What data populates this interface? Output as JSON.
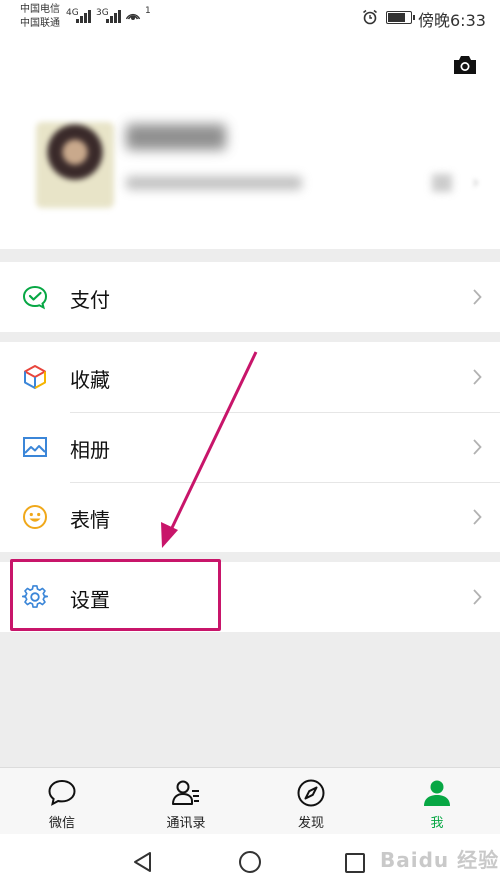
{
  "status_bar": {
    "carrier1": "中国电信",
    "carrier2": "中国联通",
    "net1": "4G",
    "net2": "3G",
    "hotspot_count": "1",
    "time": "傍晚6:33"
  },
  "menu": {
    "pay": "支付",
    "favorites": "收藏",
    "album": "相册",
    "stickers": "表情",
    "settings": "设置"
  },
  "tabs": [
    {
      "label": "微信",
      "icon": "chat-bubble-icon"
    },
    {
      "label": "通讯录",
      "icon": "contacts-icon"
    },
    {
      "label": "发现",
      "icon": "compass-icon"
    },
    {
      "label": "我",
      "icon": "person-icon",
      "active": true
    }
  ],
  "colors": {
    "accent": "#07a744",
    "highlight": "#c8156a",
    "settings_icon": "#3b86d8"
  },
  "watermark": "Baidu 经验"
}
